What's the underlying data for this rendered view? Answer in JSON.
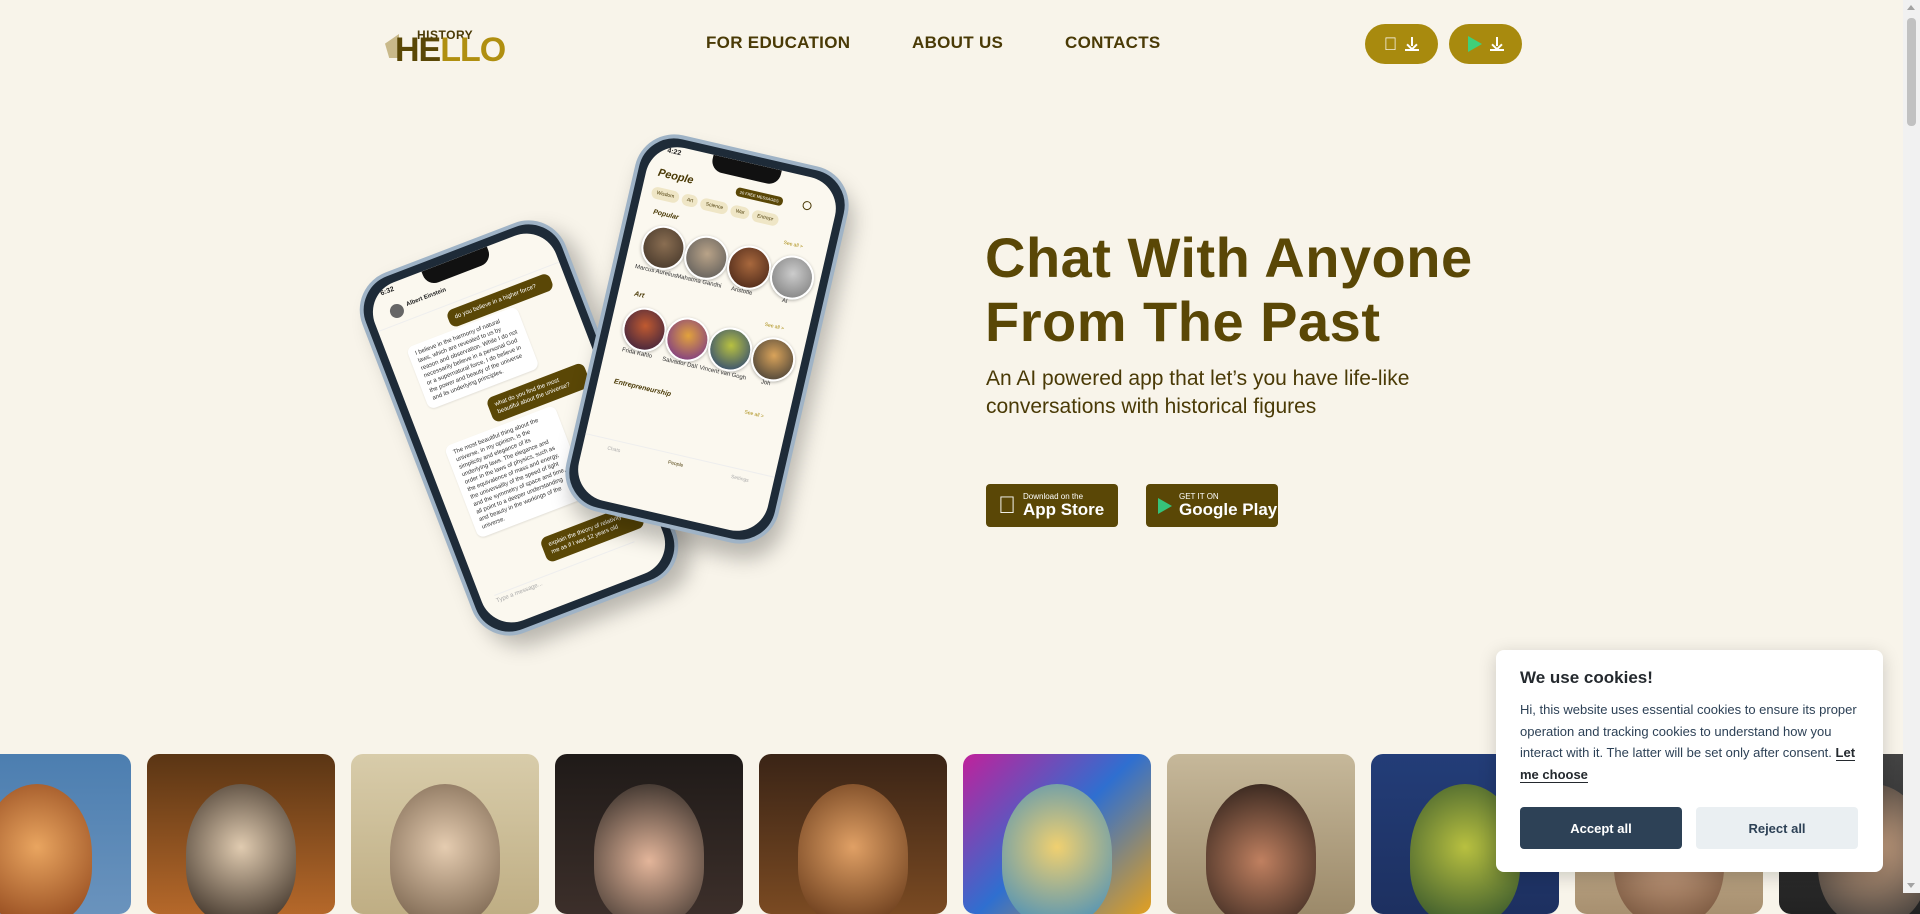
{
  "header": {
    "logo_small": "HISTORY",
    "logo_big_a": "HE",
    "logo_big_b": "LLO",
    "nav": [
      "FOR EDUCATION",
      "ABOUT US",
      "CONTACTS"
    ]
  },
  "hero": {
    "title_line1": "Chat With Anyone",
    "title_line2": "From The Past",
    "subtitle": "An AI powered app that let’s you have life-like conversations with historical figures",
    "appstore_small": "Download on the",
    "appstore_big": "App Store",
    "googleplay_small": "GET IT ON",
    "googleplay_big": "Google Play"
  },
  "phone_chat": {
    "time": "6:32",
    "contact": "Albert Einstein",
    "messages": [
      {
        "from": "me",
        "text": "do you believe in a higher force?"
      },
      {
        "from": "them",
        "text": "I believe in the harmony of natural laws, which are revealed to us by reason and observation. While I do not necessarily believe in a personal God or a supernatural force, I do believe in the power and beauty of the universe and its underlying principles."
      },
      {
        "from": "me",
        "text": "what do you find the most beautiful about the universe?"
      },
      {
        "from": "them",
        "text": "The most beautiful thing about the universe, in my opinion, is the simplicity and elegance of its underlying laws. The elegance and order in the laws of physics, such as the equivalence of mass and energy, the universality of the speed of light and the symmetry of space and time, all point to a deeper understanding and beauty in the workings of the universe."
      },
      {
        "from": "me",
        "text": "explain the theory of relativity to me as if I was 12 years old"
      }
    ],
    "input_placeholder": "Type a message..."
  },
  "phone_people": {
    "time": "4:22",
    "title": "People",
    "badge": "20 FREE MESSAGES",
    "chips": [
      "Wisdom",
      "Art",
      "Science",
      "War",
      "Entrepr"
    ],
    "section_popular": "Popular",
    "section_art": "Art",
    "section_entre": "Entrepreneurship",
    "see_all": "See all >",
    "popular": [
      "Marcus Aurelius",
      "Mahatma Gandhi",
      "Aristotle",
      "Al"
    ],
    "art": [
      "Frida Kahlo",
      "Salvador Dalí",
      "Vincent van Gogh",
      "Joh"
    ],
    "tabbar": [
      "Chats",
      "People",
      "Settings"
    ]
  },
  "cookie": {
    "title": "We use cookies!",
    "text": "Hi, this website uses essential cookies to ensure its proper operation and tracking cookies to understand how you interact with it. The latter will be set only after consent.",
    "link": "Let me choose",
    "accept": "Accept all",
    "reject": "Reject all"
  },
  "colors": {
    "background": "#f8f4ea",
    "brand_dark": "#5a4706",
    "brand_gold": "#a88a0e",
    "cookie_dark": "#2d4156"
  }
}
